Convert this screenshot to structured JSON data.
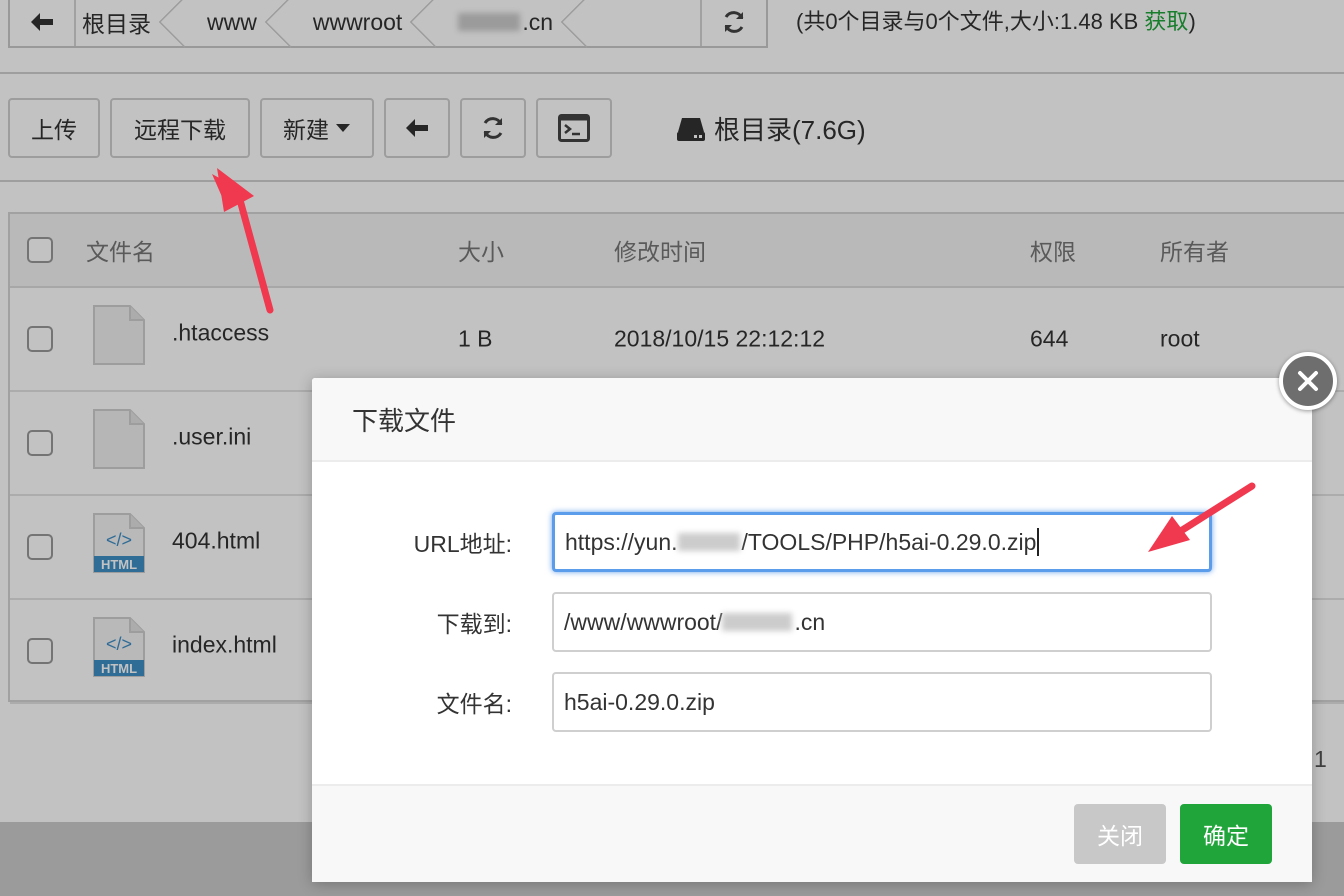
{
  "pathbar": {
    "crumbs": [
      "根目录",
      "www",
      "wwwroot",
      ".cn"
    ]
  },
  "summary": {
    "text": "(共0个目录与0个文件,大小:1.48 KB ",
    "get_label": "获取",
    "close_paren": ")"
  },
  "toolbar": {
    "upload_label": "上传",
    "remote_download_label": "远程下载",
    "new_label": "新建"
  },
  "disk": {
    "label": "根目录(7.6G)"
  },
  "table": {
    "headers": {
      "name": "文件名",
      "size": "大小",
      "mtime": "修改时间",
      "perm": "权限",
      "owner": "所有者"
    },
    "rows": [
      {
        "name": ".htaccess",
        "size": "1 B",
        "mtime": "2018/10/15 22:12:12",
        "perm": "644",
        "owner": "root",
        "icon": "file-icon"
      },
      {
        "name": ".user.ini",
        "size": "",
        "mtime": "",
        "perm": "",
        "owner": "",
        "icon": "file-icon"
      },
      {
        "name": "404.html",
        "size": "",
        "mtime": "",
        "perm": "",
        "owner": "",
        "icon": "html-file-icon"
      },
      {
        "name": "index.html",
        "size": "",
        "mtime": "",
        "perm": "",
        "owner": "",
        "icon": "html-file-icon"
      }
    ],
    "page_number": "1"
  },
  "dialog": {
    "title": "下载文件",
    "url_label": "URL地址:",
    "url_value_prefix": "https://yun.",
    "url_value_suffix": "/TOOLS/PHP/h5ai-0.29.0.zip",
    "dest_label": "下载到:",
    "dest_value_prefix": "/www/wwwroot/",
    "dest_value_suffix": ".cn",
    "filename_label": "文件名:",
    "filename_value": "h5ai-0.29.0.zip",
    "close_label": "关闭",
    "ok_label": "确定",
    "html_badge": "HTML"
  },
  "colors": {
    "accent_green": "#20a53a",
    "focus_blue": "#5b9dea",
    "annotation_red": "#f0384f"
  }
}
